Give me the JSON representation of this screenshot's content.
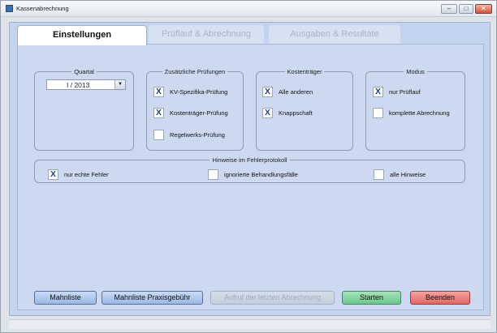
{
  "window": {
    "title": "Kassenabrechnung",
    "controls": [
      "–",
      "□",
      "✕"
    ]
  },
  "tabs": [
    {
      "label": "Einstellungen",
      "active": true
    },
    {
      "label": "Prüflauf & Abrechnung",
      "active": false
    },
    {
      "label": "Ausgaben & Resultate",
      "active": false
    }
  ],
  "quartal": {
    "legend": "Quartal",
    "value": "I / 2013"
  },
  "pruefungen": {
    "legend": "Zusätzliche Prüfungen",
    "items": [
      {
        "label": "KV-Spezifika-Prüfung",
        "checked": true
      },
      {
        "label": "Kostenträger-Prüfung",
        "checked": true
      },
      {
        "label": "Regelwerks-Prüfung",
        "checked": false
      }
    ]
  },
  "kostentraeger": {
    "legend": "Kostenträger",
    "items": [
      {
        "label": "Alle anderen",
        "checked": true
      },
      {
        "label": "Knappschaft",
        "checked": true
      }
    ]
  },
  "modus": {
    "legend": "Modus",
    "items": [
      {
        "label": "nur Prüflauf",
        "checked": true
      },
      {
        "label": "komplette Abrechnung",
        "checked": false
      }
    ]
  },
  "hinweise": {
    "legend": "Hinweise im Fehlerprotokoll",
    "items": [
      {
        "label": "nur echte Fehler",
        "checked": true
      },
      {
        "label": "ignorierte Behandlungsfälle",
        "checked": false
      },
      {
        "label": "alle Hinweise",
        "checked": false
      }
    ]
  },
  "buttons": {
    "mahnliste": "Mahnliste",
    "mahnliste_praxis": "Mahnliste Praxisgebühr",
    "aufruf": "Aufruf der letzten Abrechnung",
    "starten": "Starten",
    "beenden": "Beenden"
  },
  "check_mark": "X"
}
